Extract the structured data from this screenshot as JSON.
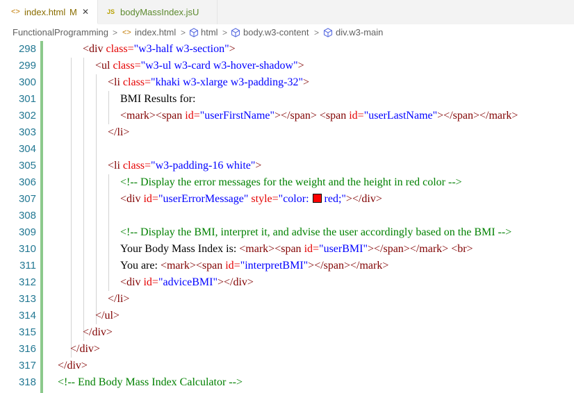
{
  "tabs": [
    {
      "icon": "<>",
      "label": "index.html",
      "badge": "M",
      "close": "✕"
    },
    {
      "icon": "JS",
      "label": "bodyMassIndex.js",
      "badge": "U"
    }
  ],
  "breadcrumb": {
    "items": [
      "FunctionalProgramming",
      "index.html",
      "html",
      "body.w3-content",
      "div.w3-main"
    ],
    "separator": ">"
  },
  "editor": {
    "line_numbers": [
      "298",
      "299",
      "300",
      "301",
      "302",
      "303",
      "304",
      "305",
      "306",
      "307",
      "308",
      "309",
      "310",
      "311",
      "312",
      "313",
      "314",
      "315",
      "316",
      "317",
      "318"
    ],
    "code": {
      "l298": {
        "o": "<div",
        "a1": "class=",
        "v1": "\"w3-half w3-section\"",
        "c": ">"
      },
      "l299": {
        "o": "<ul",
        "a1": "class=",
        "v1": "\"w3-ul w3-card w3-hover-shadow\"",
        "c": ">"
      },
      "l300": {
        "o": "<li",
        "a1": "class=",
        "v1": "\"khaki w3-xlarge w3-padding-32\"",
        "c": ">"
      },
      "l301": {
        "text": "BMI Results for:"
      },
      "l302": {
        "t1": "<mark><span",
        "a1": "id=",
        "v1": "\"userFirstName\"",
        "t2": "></span>",
        "sp": " ",
        "t3": "<span",
        "a2": "id=",
        "v2": "\"userLastName\"",
        "t4": "></span></mark>"
      },
      "l303": {
        "t1": "</li>"
      },
      "l305": {
        "o": "<li",
        "a1": "class=",
        "v1": "\"w3-padding-16 white\"",
        "c": ">"
      },
      "l306": {
        "comment": "<!-- Display the error messages for the weight and the height in red color -->"
      },
      "l307": {
        "t1": "<div",
        "a1": "id=",
        "v1": "\"userErrorMessage\"",
        "a2": "style=",
        "v2a": "\"color:",
        "v2b": "red;\"",
        "t2": "></div>"
      },
      "l309": {
        "comment": "<!-- Display the BMI, interpret it, and advise the user accordingly based on the BMI -->"
      },
      "l310": {
        "text": "Your Body Mass Index is: ",
        "t1": "<mark><span",
        "a1": "id=",
        "v1": "\"userBMI\"",
        "t2": "></span></mark>",
        "sp": " ",
        "t3": "<br>"
      },
      "l311": {
        "text": "You are: ",
        "t1": "<mark><span",
        "a1": "id=",
        "v1": "\"interpretBMI\"",
        "t2": "></span></mark>"
      },
      "l312": {
        "t1": "<div",
        "a1": "id=",
        "v1": "\"adviceBMI\"",
        "t2": "></div>"
      },
      "l313": {
        "t1": "</li>"
      },
      "l314": {
        "t1": "</ul>"
      },
      "l315": {
        "t1": "</div>"
      },
      "l316": {
        "t1": "</div>"
      },
      "l317": {
        "t1": "</div>"
      },
      "l318": {
        "comment": "<!-- End Body Mass Index Calculator -->"
      }
    }
  },
  "colors": {
    "tag": "#800000",
    "attribute": "#e50000",
    "value": "#0000ff",
    "comment": "#008000",
    "line_number": "#237893",
    "modified_gutter": "#8cc98c",
    "swatch": "#ff0000"
  }
}
